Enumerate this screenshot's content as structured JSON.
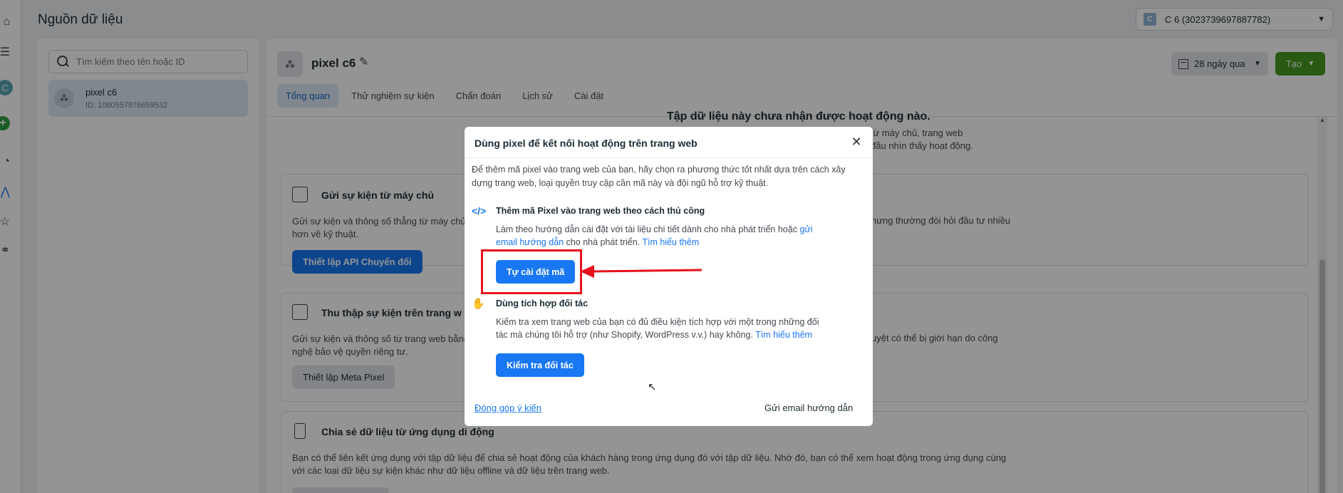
{
  "header": {
    "title": "Nguồn dữ liệu",
    "account_badge": "C",
    "account_label": "C 6 (3023739697887782)"
  },
  "rail": {
    "avatar_letter": "C"
  },
  "left_panel": {
    "search_placeholder": "Tìm kiếm theo tên hoặc ID",
    "items": [
      {
        "name": "pixel c6",
        "id_text": "ID: 1080557876659532"
      }
    ]
  },
  "dataset": {
    "name": "pixel c6",
    "date_range": "28 ngày qua",
    "create_label": "Tạo",
    "tabs": [
      "Tổng quan",
      "Thử nghiệm sự kiện",
      "Chẩn đoán",
      "Lịch sử",
      "Cài đặt"
    ],
    "active_tab": "Tổng quan",
    "no_activity_title": "Tập dữ liệu này chưa nhận được hoạt động nào.",
    "no_activity_line1": "từ máy chủ, trang web",
    "no_activity_line2": "đầu nhìn thấy hoạt động."
  },
  "cards": [
    {
      "title": "Gửi sự kiện từ máy chủ",
      "desc_line1": "Gửi sự kiện và thông số thẳng từ máy chủ",
      "desc_line2": "hơn về kỹ thuật.",
      "desc_right": "hưng thường đòi hỏi đầu tư nhiều",
      "button": "Thiết lập API Chuyển đổi"
    },
    {
      "title": "Thu thập sự kiện trên trang w",
      "desc_line1": "Gửi sự kiện và thông số từ trang web bằng",
      "desc_line2": "nghệ bảo vệ quyền riêng tư.",
      "desc_right": "uyệt có thể bị giới hạn do công",
      "button": "Thiết lập Meta Pixel"
    },
    {
      "title": "Chia sẻ dữ liệu từ ứng dụng di động",
      "desc_line1": "Bạn có thể liên kết ứng dụng với tập dữ liệu để chia sẻ hoạt động của khách hàng trong ứng dụng đó với tập dữ liệu. Nhờ đó, bạn có thể xem hoạt động trong ứng dụng cùng",
      "desc_line2": "với các loại dữ liệu sự kiện khác như dữ liệu offline và dữ liệu trên trang web."
    }
  ],
  "modal": {
    "title": "Dùng pixel để kết nối hoạt động trên trang web",
    "intro_line1": "Để thêm mã pixel vào trang web của bạn, hãy chọn ra phương thức tốt nhất dựa trên cách xây",
    "intro_line2": "dựng trang web, loại quyền truy cập cần mã này và đội ngũ hỗ trợ kỹ thuật.",
    "manual": {
      "title": "Thêm mã Pixel vào trang web theo cách thủ công",
      "line1": "Làm theo hướng dẫn cài đặt với tài liệu chi tiết dành cho nhà phát triển hoặc ",
      "line1_link": "gửi",
      "line2_link": "email hướng dẫn",
      "line2_mid": " cho nhà phát triển. ",
      "line2_link2": "Tìm hiểu thêm",
      "button": "Tự cài đặt mã"
    },
    "partner": {
      "title": "Dùng tích hợp đối tác",
      "line1": "Kiểm tra xem trang web của bạn có đủ điều kiện tích hợp với một trong những đối",
      "line2": "tác mà chúng tôi hỗ trợ (như Shopify, WordPress v.v.) hay không. ",
      "line2_link": "Tìm hiểu thêm",
      "button": "Kiểm tra đối tác"
    },
    "footer_left": "Đóng góp ý kiến",
    "footer_right": "Gửi email hướng dẫn"
  },
  "colors": {
    "accent": "#1877f2",
    "create": "#469c20",
    "annotation": "#e8101c"
  }
}
